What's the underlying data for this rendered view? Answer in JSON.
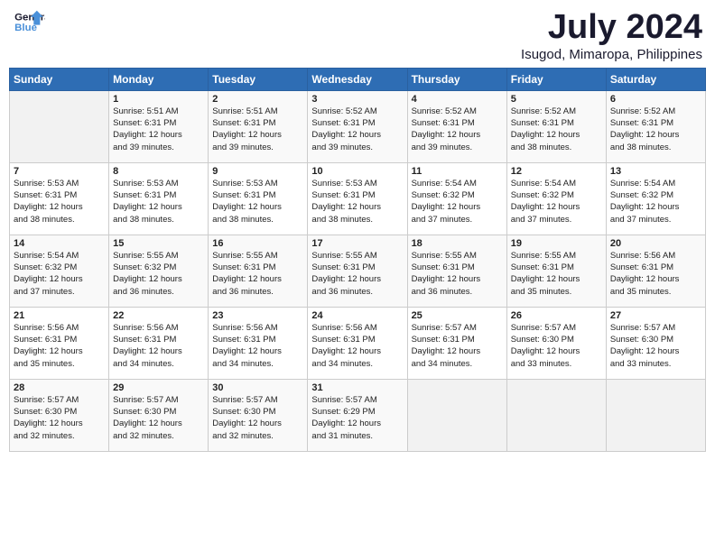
{
  "header": {
    "logo_line1": "General",
    "logo_line2": "Blue",
    "month": "July 2024",
    "location": "Isugod, Mimaropa, Philippines"
  },
  "weekdays": [
    "Sunday",
    "Monday",
    "Tuesday",
    "Wednesday",
    "Thursday",
    "Friday",
    "Saturday"
  ],
  "weeks": [
    [
      {
        "day": "",
        "info": ""
      },
      {
        "day": "1",
        "info": "Sunrise: 5:51 AM\nSunset: 6:31 PM\nDaylight: 12 hours\nand 39 minutes."
      },
      {
        "day": "2",
        "info": "Sunrise: 5:51 AM\nSunset: 6:31 PM\nDaylight: 12 hours\nand 39 minutes."
      },
      {
        "day": "3",
        "info": "Sunrise: 5:52 AM\nSunset: 6:31 PM\nDaylight: 12 hours\nand 39 minutes."
      },
      {
        "day": "4",
        "info": "Sunrise: 5:52 AM\nSunset: 6:31 PM\nDaylight: 12 hours\nand 39 minutes."
      },
      {
        "day": "5",
        "info": "Sunrise: 5:52 AM\nSunset: 6:31 PM\nDaylight: 12 hours\nand 38 minutes."
      },
      {
        "day": "6",
        "info": "Sunrise: 5:52 AM\nSunset: 6:31 PM\nDaylight: 12 hours\nand 38 minutes."
      }
    ],
    [
      {
        "day": "7",
        "info": "Sunrise: 5:53 AM\nSunset: 6:31 PM\nDaylight: 12 hours\nand 38 minutes."
      },
      {
        "day": "8",
        "info": "Sunrise: 5:53 AM\nSunset: 6:31 PM\nDaylight: 12 hours\nand 38 minutes."
      },
      {
        "day": "9",
        "info": "Sunrise: 5:53 AM\nSunset: 6:31 PM\nDaylight: 12 hours\nand 38 minutes."
      },
      {
        "day": "10",
        "info": "Sunrise: 5:53 AM\nSunset: 6:31 PM\nDaylight: 12 hours\nand 38 minutes."
      },
      {
        "day": "11",
        "info": "Sunrise: 5:54 AM\nSunset: 6:32 PM\nDaylight: 12 hours\nand 37 minutes."
      },
      {
        "day": "12",
        "info": "Sunrise: 5:54 AM\nSunset: 6:32 PM\nDaylight: 12 hours\nand 37 minutes."
      },
      {
        "day": "13",
        "info": "Sunrise: 5:54 AM\nSunset: 6:32 PM\nDaylight: 12 hours\nand 37 minutes."
      }
    ],
    [
      {
        "day": "14",
        "info": "Sunrise: 5:54 AM\nSunset: 6:32 PM\nDaylight: 12 hours\nand 37 minutes."
      },
      {
        "day": "15",
        "info": "Sunrise: 5:55 AM\nSunset: 6:32 PM\nDaylight: 12 hours\nand 36 minutes."
      },
      {
        "day": "16",
        "info": "Sunrise: 5:55 AM\nSunset: 6:31 PM\nDaylight: 12 hours\nand 36 minutes."
      },
      {
        "day": "17",
        "info": "Sunrise: 5:55 AM\nSunset: 6:31 PM\nDaylight: 12 hours\nand 36 minutes."
      },
      {
        "day": "18",
        "info": "Sunrise: 5:55 AM\nSunset: 6:31 PM\nDaylight: 12 hours\nand 36 minutes."
      },
      {
        "day": "19",
        "info": "Sunrise: 5:55 AM\nSunset: 6:31 PM\nDaylight: 12 hours\nand 35 minutes."
      },
      {
        "day": "20",
        "info": "Sunrise: 5:56 AM\nSunset: 6:31 PM\nDaylight: 12 hours\nand 35 minutes."
      }
    ],
    [
      {
        "day": "21",
        "info": "Sunrise: 5:56 AM\nSunset: 6:31 PM\nDaylight: 12 hours\nand 35 minutes."
      },
      {
        "day": "22",
        "info": "Sunrise: 5:56 AM\nSunset: 6:31 PM\nDaylight: 12 hours\nand 34 minutes."
      },
      {
        "day": "23",
        "info": "Sunrise: 5:56 AM\nSunset: 6:31 PM\nDaylight: 12 hours\nand 34 minutes."
      },
      {
        "day": "24",
        "info": "Sunrise: 5:56 AM\nSunset: 6:31 PM\nDaylight: 12 hours\nand 34 minutes."
      },
      {
        "day": "25",
        "info": "Sunrise: 5:57 AM\nSunset: 6:31 PM\nDaylight: 12 hours\nand 34 minutes."
      },
      {
        "day": "26",
        "info": "Sunrise: 5:57 AM\nSunset: 6:30 PM\nDaylight: 12 hours\nand 33 minutes."
      },
      {
        "day": "27",
        "info": "Sunrise: 5:57 AM\nSunset: 6:30 PM\nDaylight: 12 hours\nand 33 minutes."
      }
    ],
    [
      {
        "day": "28",
        "info": "Sunrise: 5:57 AM\nSunset: 6:30 PM\nDaylight: 12 hours\nand 32 minutes."
      },
      {
        "day": "29",
        "info": "Sunrise: 5:57 AM\nSunset: 6:30 PM\nDaylight: 12 hours\nand 32 minutes."
      },
      {
        "day": "30",
        "info": "Sunrise: 5:57 AM\nSunset: 6:30 PM\nDaylight: 12 hours\nand 32 minutes."
      },
      {
        "day": "31",
        "info": "Sunrise: 5:57 AM\nSunset: 6:29 PM\nDaylight: 12 hours\nand 31 minutes."
      },
      {
        "day": "",
        "info": ""
      },
      {
        "day": "",
        "info": ""
      },
      {
        "day": "",
        "info": ""
      }
    ]
  ]
}
